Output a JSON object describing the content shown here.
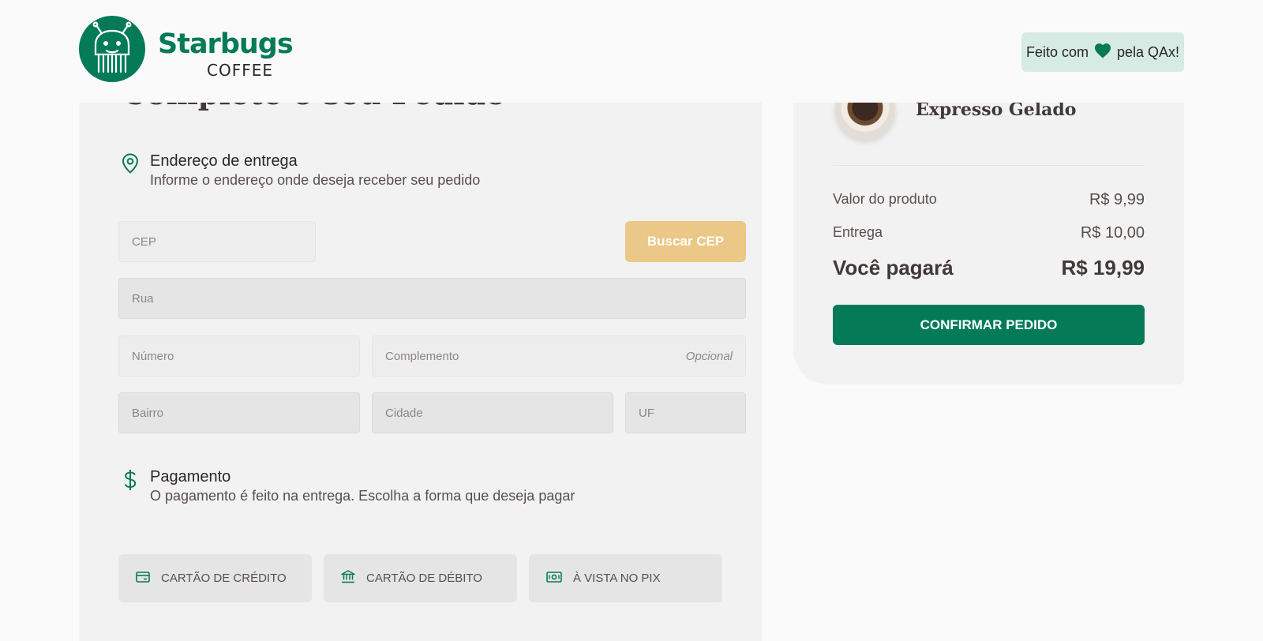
{
  "header": {
    "brand_title": "Starbugs",
    "brand_subtitle": "COFFEE",
    "made_with_prefix": "Feito com",
    "made_with_suffix": "pela QAx!"
  },
  "checkout": {
    "page_title": "Complete o seu Pedido",
    "address": {
      "title": "Endereço de entrega",
      "subtitle": "Informe o endereço onde deseja receber seu pedido",
      "cep_placeholder": "CEP",
      "search_cep_label": "Buscar CEP",
      "street_placeholder": "Rua",
      "number_placeholder": "Número",
      "complement_placeholder": "Complemento",
      "complement_optional": "Opcional",
      "district_placeholder": "Bairro",
      "city_placeholder": "Cidade",
      "state_placeholder": "UF"
    },
    "payment": {
      "title": "Pagamento",
      "subtitle": "O pagamento é feito na entrega. Escolha a forma que deseja pagar",
      "options": [
        {
          "label": "CARTÃO DE CRÉDITO",
          "icon": "credit-card-icon"
        },
        {
          "label": "CARTÃO DE DÉBITO",
          "icon": "bank-icon"
        },
        {
          "label": "À VISTA NO PIX",
          "icon": "money-icon"
        }
      ]
    }
  },
  "summary": {
    "product_name": "Expresso Gelado",
    "product_value_label": "Valor do produto",
    "product_value": "R$ 9,99",
    "delivery_label": "Entrega",
    "delivery_value": "R$ 10,00",
    "total_label": "Você pagará",
    "total_value": "R$ 19,99",
    "confirm_label": "CONFIRMAR PEDIDO"
  },
  "colors": {
    "brand_green": "#047b56",
    "accent_yellow": "#ebc887",
    "badge_bg": "#d6ebe3"
  }
}
